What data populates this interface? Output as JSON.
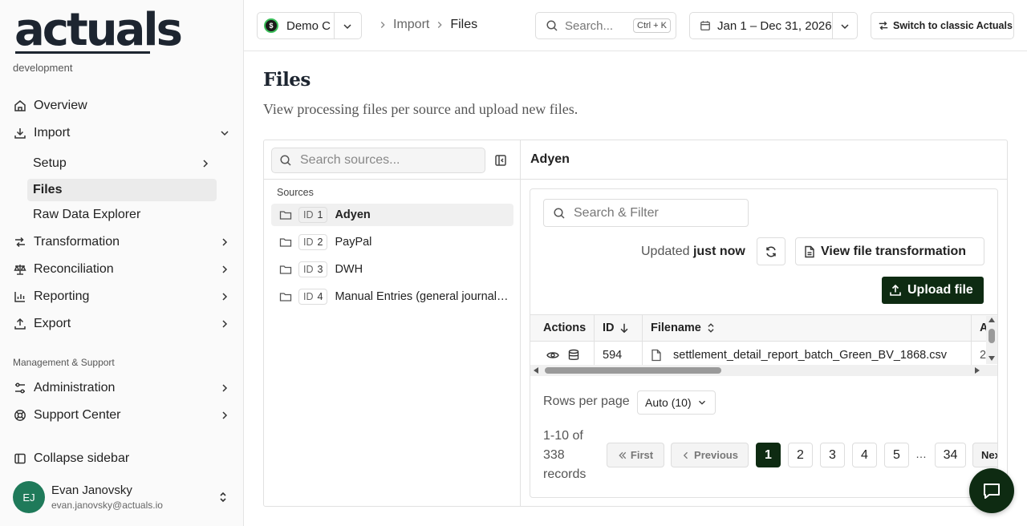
{
  "app": {
    "logo_text": "actuals",
    "environment": "development"
  },
  "sidebar": {
    "items": [
      {
        "label": "Overview",
        "icon": "home-icon"
      },
      {
        "label": "Import",
        "icon": "import-icon"
      },
      {
        "label": "Transformation",
        "icon": "transformation-icon"
      },
      {
        "label": "Reconciliation",
        "icon": "scale-icon"
      },
      {
        "label": "Reporting",
        "icon": "bar-chart-icon"
      },
      {
        "label": "Export",
        "icon": "export-icon"
      }
    ],
    "import_subitems": [
      {
        "label": "Setup"
      },
      {
        "label": "Files"
      },
      {
        "label": "Raw Data Explorer"
      }
    ],
    "section_label": "Management & Support",
    "management_items": [
      {
        "label": "Administration",
        "icon": "sliders-icon"
      },
      {
        "label": "Support Center",
        "icon": "lifebuoy-icon"
      }
    ],
    "collapse_label": "Collapse sidebar",
    "user": {
      "initials": "EJ",
      "name": "Evan Janovsky",
      "email": "evan.janovsky@actuals.io"
    }
  },
  "topbar": {
    "company": "Demo C",
    "company_badge": "$",
    "breadcrumb": [
      "Import",
      "Files"
    ],
    "search_placeholder": "Search...",
    "search_shortcut": "Ctrl + K",
    "date_range": "Jan 1 – Dec 31, 2026",
    "classic_button": "Switch to classic Actuals"
  },
  "page": {
    "title": "Files",
    "description": "View processing files per source and upload new files."
  },
  "sources_panel": {
    "search_placeholder": "Search sources...",
    "label": "Sources",
    "id_prefix": "ID",
    "items": [
      {
        "id": "1",
        "name": "Adyen",
        "active": true
      },
      {
        "id": "2",
        "name": "PayPal",
        "active": false
      },
      {
        "id": "3",
        "name": "DWH",
        "active": false
      },
      {
        "id": "4",
        "name": "Manual Entries (general journal…",
        "active": false
      }
    ]
  },
  "files_panel": {
    "title": "Adyen",
    "filter_placeholder": "Search & Filter",
    "updated_prefix": "Updated",
    "updated_value": "just now",
    "view_transformation_label": "View file transformation",
    "upload_label": "Upload file",
    "columns": [
      "Actions",
      "ID",
      "Filename",
      "A"
    ],
    "rows": [
      {
        "id": "594",
        "filename": "settlement_detail_report_batch_Green_BV_1868.csv",
        "extra": "2"
      }
    ],
    "rows_per_page_label": "Rows per page",
    "rows_per_page_value": "Auto (10)",
    "records_text": "1-10 of 338 records",
    "pagination": {
      "first": "First",
      "previous": "Previous",
      "pages": [
        "1",
        "2",
        "3",
        "4",
        "5"
      ],
      "ellipsis": "…",
      "last_page": "34",
      "next": "Nex",
      "current": "1"
    }
  },
  "colors": {
    "accent": "#0e2b12",
    "avatar": "#1f7a5a",
    "active_bg": "#ebebeb"
  }
}
